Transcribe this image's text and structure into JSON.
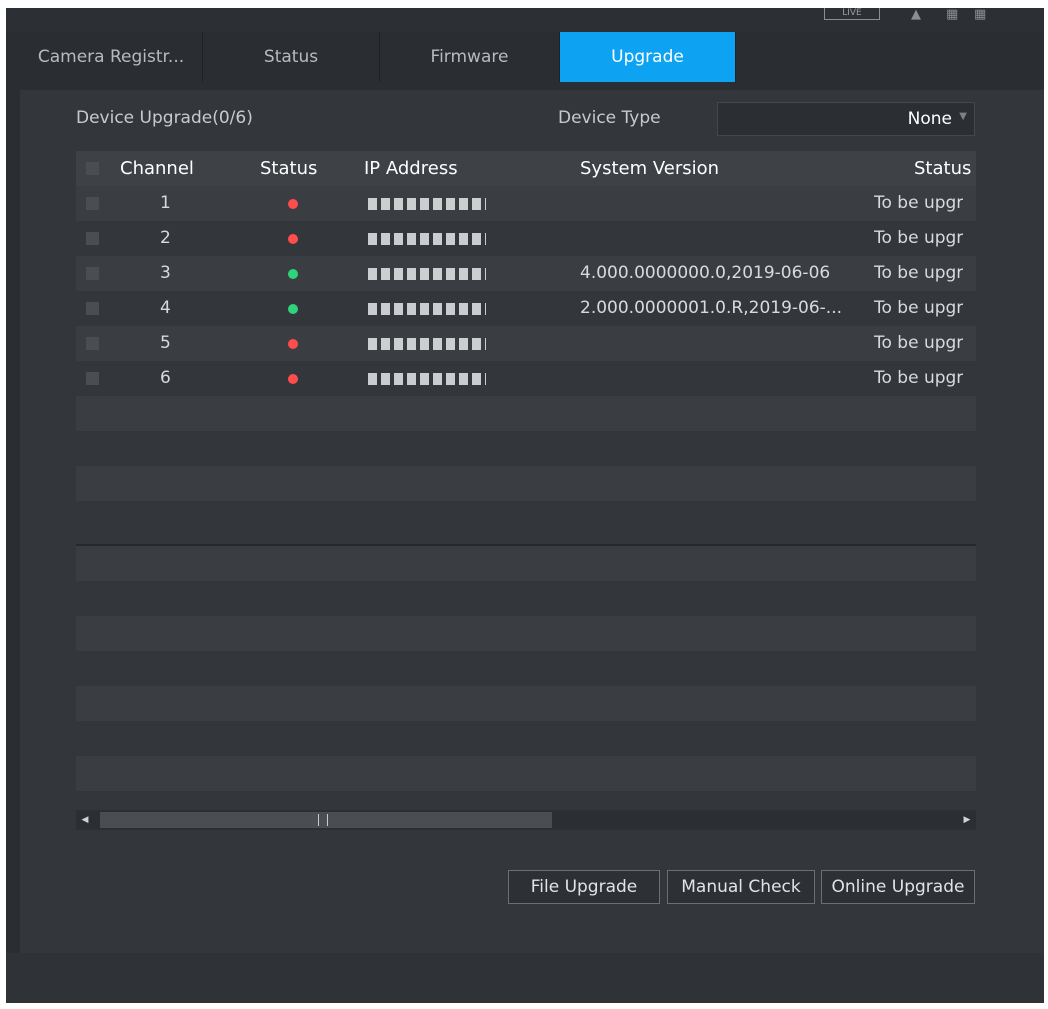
{
  "topbar": {
    "live_label": "LIVE"
  },
  "tabs": [
    {
      "label": "Camera Registr..."
    },
    {
      "label": "Status"
    },
    {
      "label": "Firmware"
    },
    {
      "label": "Upgrade"
    }
  ],
  "active_tab": "Upgrade",
  "page": {
    "device_upgrade_label": "Device Upgrade(0/6)",
    "device_type_label": "Device Type",
    "device_type_value": "None"
  },
  "table": {
    "columns": [
      "Channel",
      "Status",
      "IP Address",
      "System Version",
      "Status"
    ],
    "rows": [
      {
        "channel": "1",
        "status_color": "#ff4d4d",
        "system_version": "",
        "upgrade_status": "To be upgr"
      },
      {
        "channel": "2",
        "status_color": "#ff4d4d",
        "system_version": "",
        "upgrade_status": "To be upgr"
      },
      {
        "channel": "3",
        "status_color": "#2ed37a",
        "system_version": "4.000.0000000.0,2019-06-06",
        "upgrade_status": "To be upgr"
      },
      {
        "channel": "4",
        "status_color": "#2ed37a",
        "system_version": "2.000.0000001.0.R,2019-06-...",
        "upgrade_status": "To be upgr"
      },
      {
        "channel": "5",
        "status_color": "#ff4d4d",
        "system_version": "",
        "upgrade_status": "To be upgr"
      },
      {
        "channel": "6",
        "status_color": "#ff4d4d",
        "system_version": "",
        "upgrade_status": "To be upgr"
      }
    ]
  },
  "buttons": {
    "file_upgrade": "File Upgrade",
    "manual_check": "Manual Check",
    "online_upgrade": "Online Upgrade"
  },
  "colors": {
    "accent": "#0ea3f2",
    "offline": "#ff4d4d",
    "online": "#2ed37a"
  }
}
